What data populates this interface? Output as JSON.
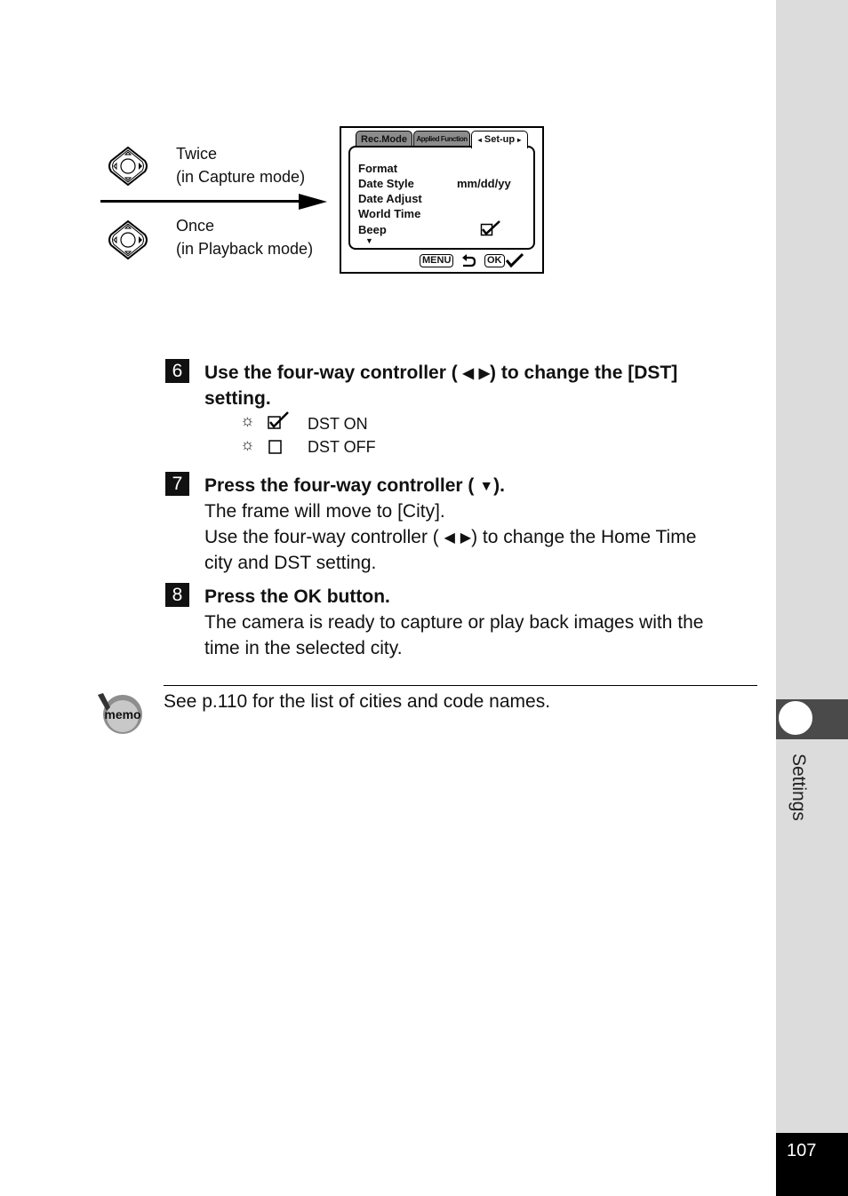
{
  "diagram": {
    "top_caption": [
      "Twice",
      "(in Capture mode)"
    ],
    "bottom_caption": [
      "Once",
      "(in Playback mode)"
    ],
    "screen": {
      "tabs": [
        {
          "label": "Rec.Mode",
          "active": false
        },
        {
          "label": "Applied Function",
          "active": false
        },
        {
          "label": "Set-up",
          "active": true
        }
      ],
      "tab_arrow_left": "◂",
      "tab_arrow_right": "▸",
      "items": [
        {
          "label": "Format",
          "value": ""
        },
        {
          "label": "Date Style",
          "value": "mm/dd/yy"
        },
        {
          "label": "Date Adjust",
          "value": ""
        },
        {
          "label": "World Time",
          "value": ""
        },
        {
          "label": "Beep",
          "value": "checked"
        }
      ],
      "more_indicator": "▼",
      "footer": {
        "menu_key": "MENU",
        "menu_icon": "back-arrow",
        "ok_key": "OK",
        "ok_icon": "check"
      }
    }
  },
  "steps": [
    {
      "number": "6",
      "heading_parts": [
        "Use the four-way controller (",
        "◀",
        "▶",
        ") to change the [DST]"
      ],
      "heading_line2": "setting.",
      "options": [
        {
          "icon": "sun-blink",
          "check": "checked",
          "label": "DST ON"
        },
        {
          "icon": "sun-blink",
          "check": "unchecked",
          "label": "DST OFF"
        }
      ]
    },
    {
      "number": "7",
      "heading_parts": [
        "Press the four-way controller (",
        "▼",
        ")."
      ],
      "body": [
        "The frame will move to [City]."
      ],
      "body2_parts": [
        "Use the four-way controller (",
        "◀",
        "▶",
        ") to change the Home Time"
      ],
      "body3": "city and DST setting."
    },
    {
      "number": "8",
      "heading": "Press the OK button.",
      "body": [
        "The camera is ready to capture or play back images with the",
        "time in the selected city."
      ]
    }
  ],
  "memo": {
    "icon_label": "memo",
    "text": "See p.110 for the list of cities and code names."
  },
  "side_tab": {
    "label": "Settings"
  },
  "page_number": "107"
}
